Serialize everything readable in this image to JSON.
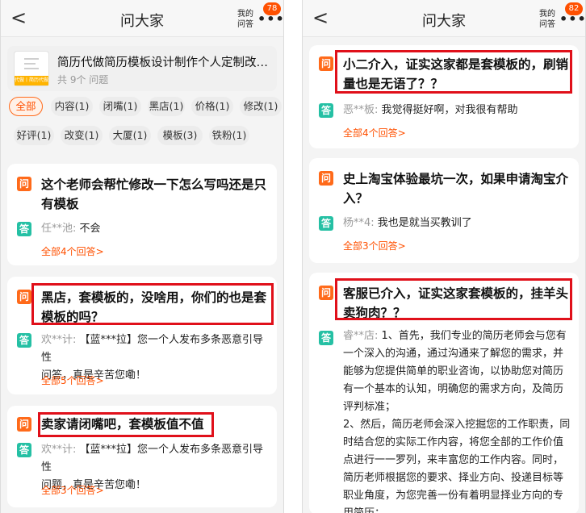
{
  "left": {
    "nav": {
      "back": "<",
      "title": "问大家",
      "mine_line1": "我的",
      "mine_line2": "问答",
      "more": "•••",
      "badge": "78"
    },
    "product": {
      "title": "简历代做简历模板设计制作个人定制改应届生...",
      "count": "共 9个 问题",
      "thumb_tag": "代做丨简历代做"
    },
    "chips": [
      "全部",
      "内容(1)",
      "闭嘴(1)",
      "黑店(1)",
      "价格(1)",
      "修改(1)",
      "好评(1)",
      "改变(1)",
      "大厦(1)",
      "模板(3)",
      "铁粉(1)"
    ],
    "cards": [
      {
        "q1": "这个老师会帮忙修改一下怎么写吗还是只",
        "q2": "有模板",
        "user": "任**池:",
        "answer": "不会",
        "more": "全部4个回答",
        "q_icon": "问",
        "a_icon": "答"
      },
      {
        "q1": "黑店，套模板的，没啥用，你们的也是套",
        "q2": "模板的吗？",
        "user": "欢**计:",
        "a1": "【蓝***拉】您一个人发布多条恶意引导性",
        "a2": "问答，真是辛苦您嘞！",
        "more": "全部5个回答",
        "q_icon": "问",
        "a_icon": "答"
      },
      {
        "q1": "卖家请闭嘴吧，套模板值不值",
        "user": "欢**计:",
        "a1": "【蓝***拉】您一个人发布多条恶意引导性",
        "a2": "问题，真是辛苦您嘞！",
        "more": "全部3个回答",
        "q_icon": "问",
        "a_icon": "答"
      }
    ]
  },
  "right": {
    "nav": {
      "back": "<",
      "title": "问大家",
      "mine_line1": "我的",
      "mine_line2": "问答",
      "more": "•••",
      "badge": "82"
    },
    "cards": [
      {
        "q1": "小二介入，证实这家都是套模板的，刷销",
        "q2": "量也是无语了？？",
        "user": "恶**板:",
        "answer": "我觉得挺好啊，对我很有帮助",
        "more": "全部4个回答",
        "q_icon": "问",
        "a_icon": "答"
      },
      {
        "q1": "史上淘宝体验最坑一次，如果申请淘宝介",
        "q2": "入？",
        "user": "杨**4:",
        "answer": "我也是就当买教训了",
        "more": "全部3个回答",
        "q_icon": "问",
        "a_icon": "答"
      },
      {
        "q1": "客服已介入，证实这家套模板的，挂羊头",
        "q2": "卖狗肉？？",
        "user": "睿**店:",
        "lines": [
          "1、首先，我们专业的简历老师会与您有",
          "一个深入的沟通，通过沟通来了解您的需求，并",
          "能够为您提供简单的职业咨询，以协助您对简历",
          "有一个基本的认知，明确您的需求方向，及简历",
          "评判标准；",
          "2、然后，简历老师会深入挖掘您的工作职责，同",
          "时结合您的实际工作内容，将您全部的工作价值",
          "点进行一一罗列，来丰富您的工作内容。同时，",
          "简历老师根据您的要求、择业方向、投递目标等",
          "职业角度，为您完善一份有着明显择业方向的专",
          "用简历；"
        ],
        "q_icon": "问",
        "a_icon": "答"
      }
    ]
  }
}
